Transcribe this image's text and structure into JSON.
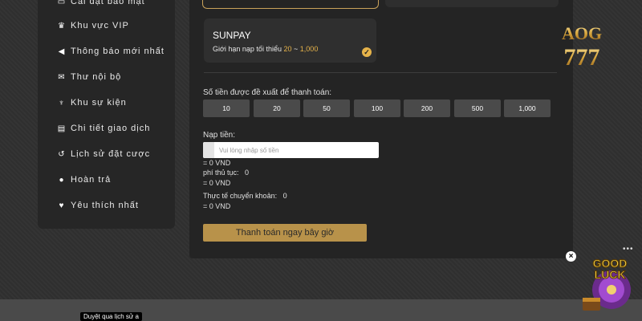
{
  "sidebar": {
    "items": [
      {
        "label": "Cài đặt bảo mật",
        "icon": "card-icon"
      },
      {
        "label": "Khu vực VIP",
        "icon": "crown-icon"
      },
      {
        "label": "Thông báo mới nhất",
        "icon": "megaphone-icon"
      },
      {
        "label": "Thư nội bộ",
        "icon": "mail-icon"
      },
      {
        "label": "Khu sự kiện",
        "icon": "trophy-icon"
      },
      {
        "label": "Chi tiết giao dịch",
        "icon": "clipboard-icon"
      },
      {
        "label": "Lịch sử đặt cược",
        "icon": "history-icon"
      },
      {
        "label": "Hoàn trả",
        "icon": "refund-icon"
      },
      {
        "label": "Yêu thích nhất",
        "icon": "heart-icon"
      }
    ]
  },
  "payment": {
    "method_name": "SUNPAY",
    "limit_prefix": "Giới hạn nạp tối thiểu",
    "limit_min": "20",
    "limit_sep": "~",
    "limit_max": "1,000",
    "suggest_label": "Số tiền được đề xuất để thanh toán:",
    "amounts": [
      "10",
      "20",
      "50",
      "100",
      "200",
      "500",
      "1,000"
    ],
    "deposit_label": "Nạp tiền:",
    "deposit_placeholder": "Vui lòng nhập số tiền",
    "deposit_vnd": "= 0 VND",
    "fee_label": "phí thủ tục:",
    "fee_value": "0",
    "fee_vnd": "= 0 VND",
    "actual_label": "Thực tế chuyển khoản:",
    "actual_value": "0",
    "actual_vnd": "= 0 VND",
    "pay_button": "Thanh toán ngay bây giờ"
  },
  "logo": {
    "line1": "AOG",
    "line2": "777"
  },
  "popup": {
    "close": "×",
    "dots": "•••",
    "badge_line1": "GOOD",
    "badge_line2": "LUCK"
  },
  "tooltip": "Duyệt qua lịch sử a",
  "colors": {
    "accent": "#e6b34a",
    "button_gold": "#b8924a",
    "panel": "#242424",
    "sidebar": "#262626"
  }
}
